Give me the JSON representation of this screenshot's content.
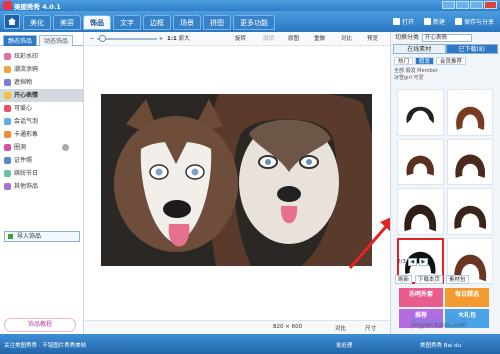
{
  "window": {
    "title": "美图秀秀 4.0.1"
  },
  "menu": {
    "tabs": [
      "美化",
      "美容",
      "饰品",
      "文字",
      "边框",
      "场景",
      "拼图",
      "更多功能"
    ],
    "active_index": 2,
    "right": [
      "打开",
      "新建",
      "保存与分享"
    ]
  },
  "left_panel": {
    "tabs": [
      "静态饰品",
      "动态饰品"
    ],
    "categories": [
      "炫彩水印",
      "潮流涂鸦",
      "遮挡物",
      "开心表情",
      "可爱心",
      "会话气泡",
      "卡通形象",
      "圈洞",
      "证件照",
      "缤纷节日",
      "其他饰品"
    ],
    "active_category": "开心表情",
    "import_label": "导入饰品",
    "tutorial_label": "饰品教程"
  },
  "toolbar": {
    "zoom_value": "1:1",
    "zoom_label": "原大",
    "rotate": "旋转",
    "undo": "撤销",
    "original": "原图",
    "redo": "重做",
    "compare": "对比",
    "preview": "预览"
  },
  "canvas_status": {
    "size": "820 × 600",
    "compare_label": "对比",
    "ruler_label": "尺寸"
  },
  "right_panel": {
    "category_label": "切换分类",
    "selected_category": "开心表情",
    "tabs": [
      "在线素材",
      "已下载(8)"
    ],
    "subtabs": [
      "热门",
      "假发",
      "会员推荐"
    ],
    "filter_line1": "全部 假发 Member",
    "filter_active": "假发",
    "filter_line2": "冰雪girl 可爱",
    "pager": "2/3",
    "actions": [
      "刷新",
      "下载本页",
      "素材包"
    ],
    "promo": [
      "乐呵外套",
      "每日精选",
      "推荐",
      "大礼包"
    ]
  },
  "bottom_bar": {
    "left_text": "关注美图秀秀 · 不错图片秀秀美帖",
    "right_items": [
      "批处理",
      "美图秀秀 Bai du"
    ]
  },
  "watermark": {
    "main": "Baidu 经验",
    "sub": "jingyan.baidu.com"
  }
}
